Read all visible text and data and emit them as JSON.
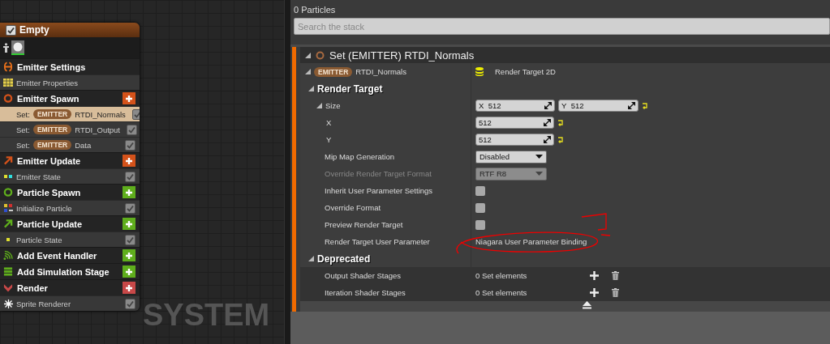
{
  "graph": {
    "canvas_label": "SYSTEM",
    "node": {
      "title": "Empty",
      "enabled": true,
      "rows": [
        {
          "kind": "header",
          "label": "Emitter Settings",
          "color": "#e8701a",
          "add_button": false
        },
        {
          "kind": "plain",
          "label": "Emitter Properties"
        },
        {
          "kind": "header",
          "label": "Emitter Spawn",
          "color": "#d4521a",
          "add_button": true
        },
        {
          "kind": "module",
          "prefix": "Set:",
          "tag": "EMITTER",
          "label": "RTDI_Normals",
          "selected": true,
          "checked": true
        },
        {
          "kind": "module",
          "prefix": "Set:",
          "tag": "EMITTER",
          "label": "RTDI_Output",
          "selected": false,
          "checked": true
        },
        {
          "kind": "module",
          "prefix": "Set:",
          "tag": "EMITTER",
          "label": "Data",
          "selected": false,
          "checked": true
        },
        {
          "kind": "header",
          "label": "Emitter Update",
          "color": "#d4521a",
          "add_button": true
        },
        {
          "kind": "module",
          "label": "Emitter State",
          "selected": false,
          "checked": true
        },
        {
          "kind": "header",
          "label": "Particle Spawn",
          "color": "#5fae1c",
          "add_button": true
        },
        {
          "kind": "module",
          "label": "Initialize Particle",
          "selected": false,
          "checked": true
        },
        {
          "kind": "header",
          "label": "Particle Update",
          "color": "#5fae1c",
          "add_button": true
        },
        {
          "kind": "module",
          "label": "Particle State",
          "selected": false,
          "checked": true
        },
        {
          "kind": "header",
          "label": "Add Event Handler",
          "color": "#5fae1c",
          "add_button": true
        },
        {
          "kind": "header",
          "label": "Add Simulation Stage",
          "color": "#5fae1c",
          "add_button": true
        },
        {
          "kind": "header",
          "label": "Render",
          "color": "#c84848",
          "add_button": true
        },
        {
          "kind": "module",
          "label": "Sprite Renderer",
          "selected": false,
          "checked": true
        }
      ]
    }
  },
  "stack": {
    "particle_count": "0 Particles",
    "search": {
      "placeholder": "Search the stack"
    },
    "module": {
      "title": "Set (EMITTER) RTDI_Normals",
      "expanded": true,
      "parameter": {
        "tag": "EMITTER",
        "name": "RTDI_Normals",
        "type": "Render Target 2D",
        "expanded": true
      },
      "categories": [
        {
          "title": "Render Target",
          "expanded": true,
          "properties": [
            {
              "kind": "vector",
              "label": "Size",
              "expanded": true,
              "fields": [
                {
                  "axis": "X",
                  "value": "512"
                },
                {
                  "axis": "Y",
                  "value": "512"
                }
              ],
              "reset": true,
              "children": [
                {
                  "kind": "number",
                  "label": "X",
                  "value": "512",
                  "reset": true
                },
                {
                  "kind": "number",
                  "label": "Y",
                  "value": "512",
                  "reset": true
                }
              ]
            },
            {
              "kind": "dropdown",
              "label": "Mip Map Generation",
              "value": "Disabled",
              "disabled": false
            },
            {
              "kind": "dropdown",
              "label": "Override Render Target Format",
              "value": "RTF R8",
              "disabled": true
            },
            {
              "kind": "checkbox",
              "label": "Inherit User Parameter Settings",
              "checked": false
            },
            {
              "kind": "checkbox",
              "label": "Override Format",
              "checked": false
            },
            {
              "kind": "checkbox",
              "label": "Preview Render Target",
              "checked": false
            },
            {
              "kind": "text",
              "label": "Render Target User Parameter",
              "value": "Niagara User Parameter Binding"
            }
          ]
        },
        {
          "title": "Deprecated",
          "expanded": true,
          "properties": [
            {
              "kind": "set",
              "label": "Output Shader Stages",
              "value": "0 Set elements"
            },
            {
              "kind": "set",
              "label": "Iteration Shader Stages",
              "value": "0 Set elements"
            }
          ]
        }
      ]
    }
  }
}
